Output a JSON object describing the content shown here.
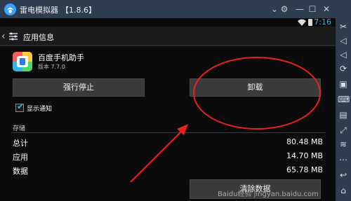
{
  "window": {
    "title": "雷电模拟器",
    "version": "【1.8.6】",
    "controls": [
      "chevron-down-icon",
      "gear-icon",
      "minimize-icon",
      "maximize-icon",
      "close-icon"
    ]
  },
  "statusbar": {
    "time": "7:16"
  },
  "actionbar": {
    "title": "应用信息"
  },
  "app": {
    "name": "百度手机助手",
    "version": "版本 7.7.0"
  },
  "buttons": {
    "force_stop": "强行停止",
    "uninstall": "卸载",
    "clear_data": "清除数据"
  },
  "notifications": {
    "label": "显示通知",
    "checked": true
  },
  "storage": {
    "heading": "存储",
    "rows": [
      {
        "label": "总计",
        "value": "80.48 MB"
      },
      {
        "label": "应用",
        "value": "14.70 MB"
      },
      {
        "label": "数据",
        "value": "65.78 MB"
      }
    ]
  },
  "watermark": "Baidu经验 jingyan.baidu.com",
  "colors": {
    "accent": "#33b5e5",
    "annotation": "#e8231d",
    "titlebar": "#2e3d50"
  },
  "sidebar_icons": [
    "scissors-icon",
    "volume-up-icon",
    "volume-down-icon",
    "rotate-icon",
    "screenshot-icon",
    "keyboard-icon",
    "apk-install-icon",
    "fullscreen-icon",
    "shake-icon",
    "more-icon",
    "back-icon",
    "home-icon"
  ]
}
